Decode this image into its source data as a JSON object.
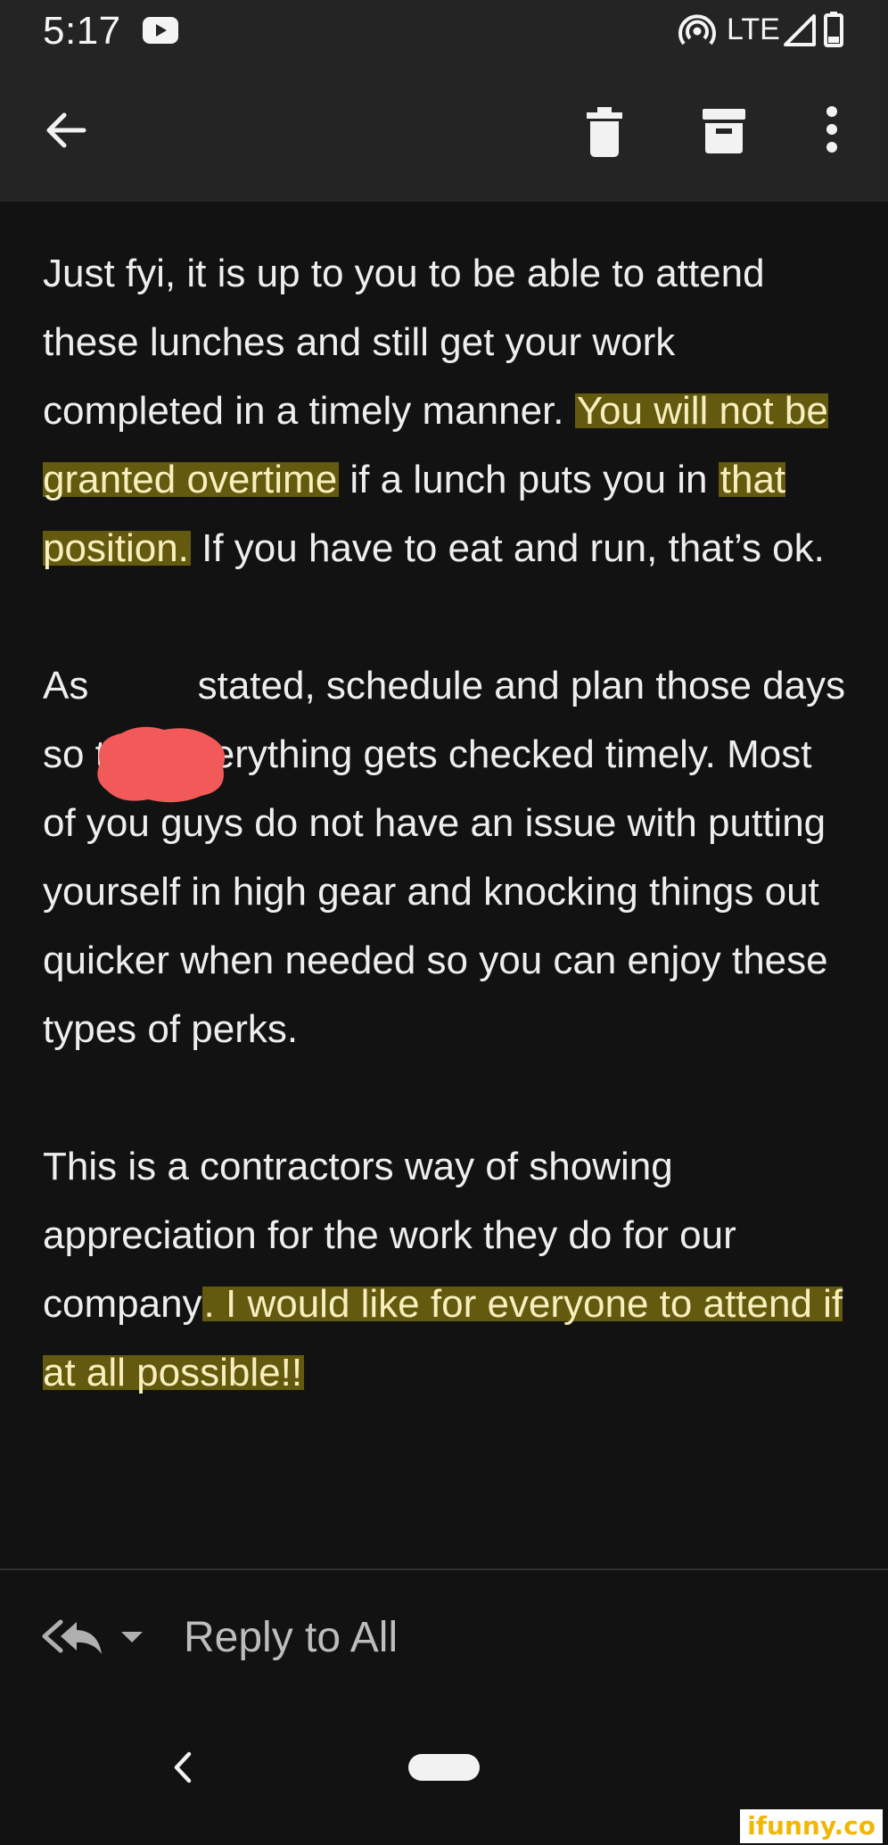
{
  "status_bar": {
    "time": "5:17",
    "network": "LTE",
    "icons": [
      "youtube-icon",
      "hotspot-icon",
      "signal-icon",
      "battery-icon"
    ]
  },
  "toolbar": {
    "icons": [
      "back-arrow-icon",
      "trash-icon",
      "archive-icon",
      "more-vertical-icon"
    ]
  },
  "email": {
    "paragraphs": [
      {
        "segments": [
          {
            "text": "Just fyi, it is up to you to be able to attend these lunches and still get your work completed in a timely manner. ",
            "highlight": false
          },
          {
            "text": "You will not be granted overtime",
            "highlight": true
          },
          {
            "text": " if a lunch puts you in ",
            "highlight": false
          },
          {
            "text": "that position.",
            "highlight": true
          },
          {
            "text": " If you have to eat and run, that’s ok.",
            "highlight": false
          }
        ]
      },
      {
        "segments": [
          {
            "text": "As",
            "highlight": false
          },
          {
            "text": "          ",
            "highlight": false
          },
          {
            "text": "stated, schedule and plan those days so that everything gets checked timely. Most of you guys do not have an issue with putting yourself in high gear and knocking things out quicker when needed so you can enjoy these types of perks.",
            "highlight": false
          }
        ]
      },
      {
        "segments": [
          {
            "text": "This is a contractors way of showing appreciation for the work they do for our company",
            "highlight": false
          },
          {
            "text": ". I would like for everyone to attend if at all possible!!",
            "highlight": true
          }
        ]
      }
    ]
  },
  "reply_bar": {
    "label": "Reply to All",
    "icons": [
      "reply-all-icon",
      "chevron-down-icon"
    ]
  },
  "nav_bar": {
    "icons": [
      "nav-back-icon",
      "home-pill"
    ]
  },
  "watermark": {
    "text": "ifunny.co"
  },
  "colors": {
    "background": "#121212",
    "bar": "#242424",
    "text": "#eeeeee",
    "highlight": "#85790e",
    "redaction": "#f25a5a"
  }
}
